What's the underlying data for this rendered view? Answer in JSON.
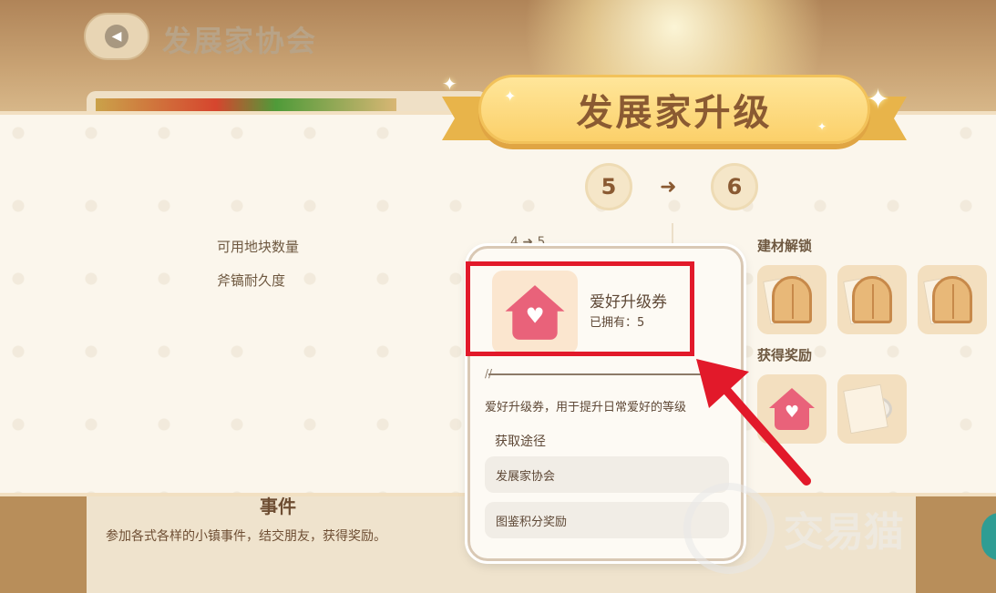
{
  "header": {
    "title": "发展家协会",
    "back_icon": "back-arrow-icon"
  },
  "banner": {
    "title": "发展家升级"
  },
  "levels": {
    "from": "5",
    "to": "6",
    "arrow": "➜"
  },
  "stats": [
    {
      "label": "可用地块数量"
    },
    {
      "label": "斧镐耐久度"
    }
  ],
  "stat_value_partial": "4 ➜ 5",
  "sections": {
    "unlock_label": "建材解锁",
    "reward_label": "获得奖励"
  },
  "popup": {
    "item_name": "爱好升级券",
    "owned": "已拥有：5",
    "description": "爱好升级券，用于提升日常爱好的等级",
    "source_title": "获取途径",
    "sources": [
      "发展家协会",
      "图鉴积分奖励"
    ]
  },
  "event": {
    "title": "事件",
    "description": "参加各式各样的小镇事件，结交朋友，获得奖励。"
  },
  "watermark": {
    "text": "交易猫"
  },
  "colors": {
    "highlight": "#e2192a",
    "banner": "#fbd06a",
    "teal": "#2f9d93"
  }
}
